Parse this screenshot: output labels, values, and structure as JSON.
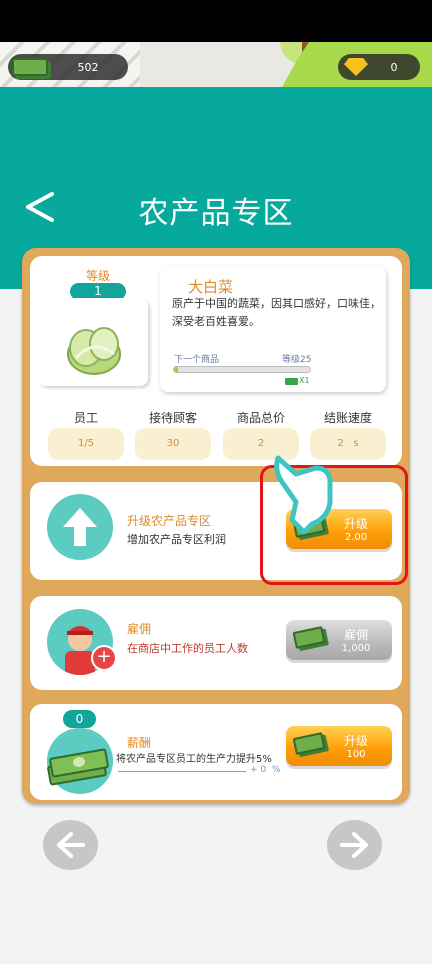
{
  "topbar": {
    "money": "502",
    "gems": "0"
  },
  "header": {
    "title": "农产品专区"
  },
  "product": {
    "level_label": "等级",
    "level": "1",
    "name": "大白菜",
    "description": "原产于中国的蔬菜，因其口感好，口味佳，深受老百姓喜爱。",
    "next_label": "下一个商品",
    "next_level": "等级25",
    "progress": 0.03,
    "multiplier": "X1"
  },
  "stats": [
    {
      "label": "员工",
      "value": "1/5"
    },
    {
      "label": "接待顾客",
      "value": "30"
    },
    {
      "label": "商品总价",
      "value": "2"
    },
    {
      "label": "结账速度",
      "value": "2   s"
    }
  ],
  "upgrade_area": {
    "title": "升级农产品专区",
    "subtitle": "增加农产品专区利润",
    "button_label": "升级",
    "button_price": "2.00"
  },
  "hire": {
    "title": "雇佣",
    "subtitle": "在商店中工作的员工人数",
    "button_label": "雇佣",
    "button_price": "1,000"
  },
  "salary": {
    "badge": "0",
    "title": "薪酬",
    "subtitle": "将农产品专区员工的生产力提升5%",
    "progress_text": "+ 0  %",
    "button_label": "升级",
    "button_price": "100"
  },
  "colors": {
    "teal": "#07a99d",
    "orange": "#ff9f0a",
    "label_orange": "#e08a2a",
    "panel": "#dfa85a",
    "highlight": "#e0161b"
  }
}
